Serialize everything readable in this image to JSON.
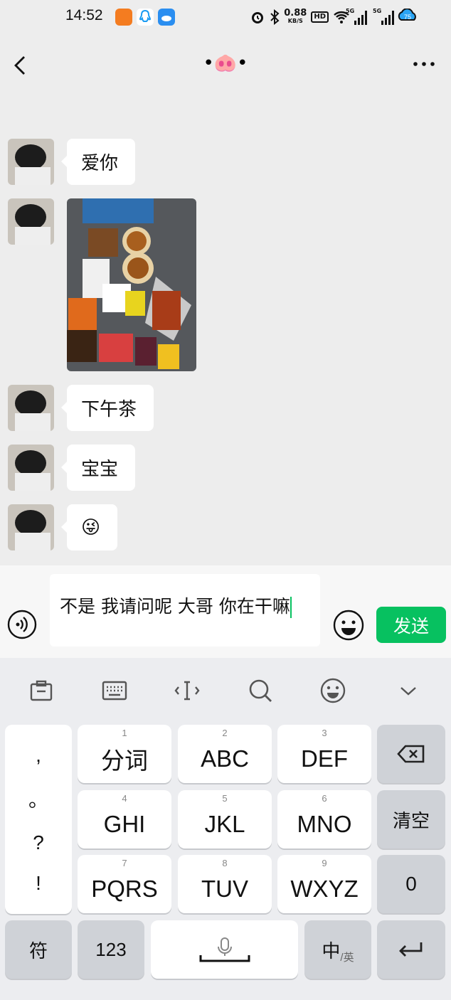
{
  "status_bar": {
    "time": "14:52",
    "speed_value": "0.88",
    "speed_unit": "KB/S",
    "hd_label": "HD",
    "network_label_1": "5G",
    "network_label_2": "5G",
    "battery_level": "75"
  },
  "nav": {
    "title": "•🐽•"
  },
  "messages": [
    {
      "type": "text",
      "text": "爱你"
    },
    {
      "type": "image"
    },
    {
      "type": "text",
      "text": "下午茶"
    },
    {
      "type": "text",
      "text": "宝宝"
    },
    {
      "type": "text",
      "text": "😜"
    }
  ],
  "input": {
    "value": "不是 我请问呢  大哥 你在干嘛",
    "send_label": "发送"
  },
  "keyboard": {
    "punct": [
      ",",
      "。",
      "?",
      "!"
    ],
    "keys": [
      {
        "num": "1",
        "label": "分词"
      },
      {
        "num": "2",
        "label": "ABC"
      },
      {
        "num": "3",
        "label": "DEF"
      },
      {
        "num": "4",
        "label": "GHI"
      },
      {
        "num": "5",
        "label": "JKL"
      },
      {
        "num": "6",
        "label": "MNO"
      },
      {
        "num": "7",
        "label": "PQRS"
      },
      {
        "num": "8",
        "label": "TUV"
      },
      {
        "num": "9",
        "label": "WXYZ"
      }
    ],
    "clear_label": "清空",
    "zero_label": "0",
    "symbol_label": "符",
    "numeric_label": "123",
    "lang_main": "中",
    "lang_sub": "/英"
  },
  "colors": {
    "accent": "#07c160",
    "background": "#ededed"
  },
  "icons": [
    "back-arrow-icon",
    "more-icon",
    "voice-icon",
    "emoji-icon",
    "backspace-icon",
    "mic-icon",
    "enter-icon",
    "clipboard-icon",
    "keyboard-icon",
    "cursor-icon",
    "search-icon",
    "smiley-icon",
    "chevron-down-icon"
  ]
}
